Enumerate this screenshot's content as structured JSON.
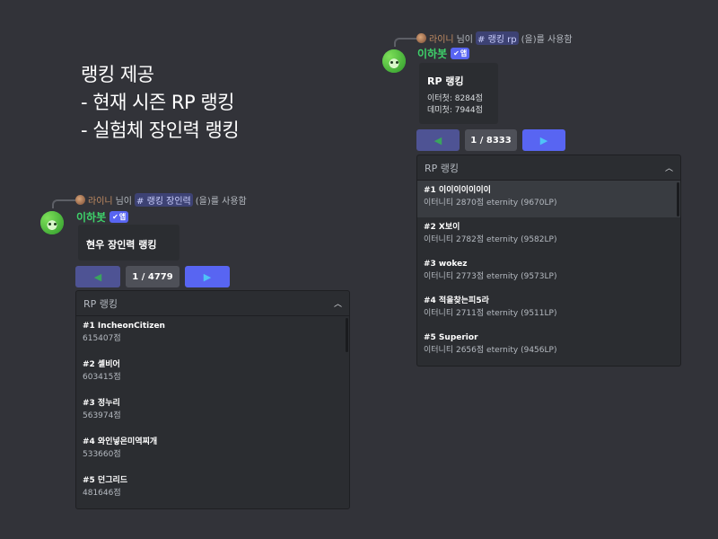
{
  "promo": {
    "line1": "랭킹 제공",
    "line2": "- 현재 시즌 RP 랭킹",
    "line3": "- 실험체 장인력 랭킹"
  },
  "right_msg": {
    "reply_user": "라이니",
    "reply_mid": "님이",
    "reply_cmd": "# 랭킹 rp",
    "reply_end": "(을)를 사용함",
    "bot_name": "이하봇",
    "app_tag": "앱",
    "embed_title": "RP 랭킹",
    "embed_lines": [
      "이터첫: 8284점",
      "데미첫: 7944점"
    ],
    "prev": "◀",
    "page": "1 / 8333",
    "next": "▶",
    "dropdown_label": "RP 랭킹",
    "options": [
      {
        "label": "#1 이이이이이이이",
        "desc": "이터니티 2870점 eternity (9670LP)"
      },
      {
        "label": "#2 X보이",
        "desc": "이터니티 2782점 eternity (9582LP)"
      },
      {
        "label": "#3 wokez",
        "desc": "이터니티 2773점 eternity (9573LP)"
      },
      {
        "label": "#4 적을찾는피5라",
        "desc": "이터니티 2711점 eternity (9511LP)"
      },
      {
        "label": "#5 Superior",
        "desc": "이터니티 2656점 eternity (9456LP)"
      }
    ]
  },
  "left_msg": {
    "reply_user": "라이니",
    "reply_mid": "님이",
    "reply_cmd": "# 랭킹 장인력",
    "reply_end": "(을)를 사용함",
    "bot_name": "이하봇",
    "app_tag": "앱",
    "embed_title": "현우 장인력 랭킹",
    "prev": "◀",
    "page": "1 / 4779",
    "next": "▶",
    "dropdown_label": "RP 랭킹",
    "options": [
      {
        "label": "#1 IncheonCitizen",
        "desc": "615407점"
      },
      {
        "label": "#2 셸비어",
        "desc": "603415점"
      },
      {
        "label": "#3 정누리",
        "desc": "563974점"
      },
      {
        "label": "#4 와인넣은미역찌개",
        "desc": "533660점"
      },
      {
        "label": "#5 던그리드",
        "desc": "481646점"
      }
    ]
  },
  "colors": {
    "background": "#323339",
    "bot_name": "#3ed36a",
    "blurple": "#5865f2"
  }
}
